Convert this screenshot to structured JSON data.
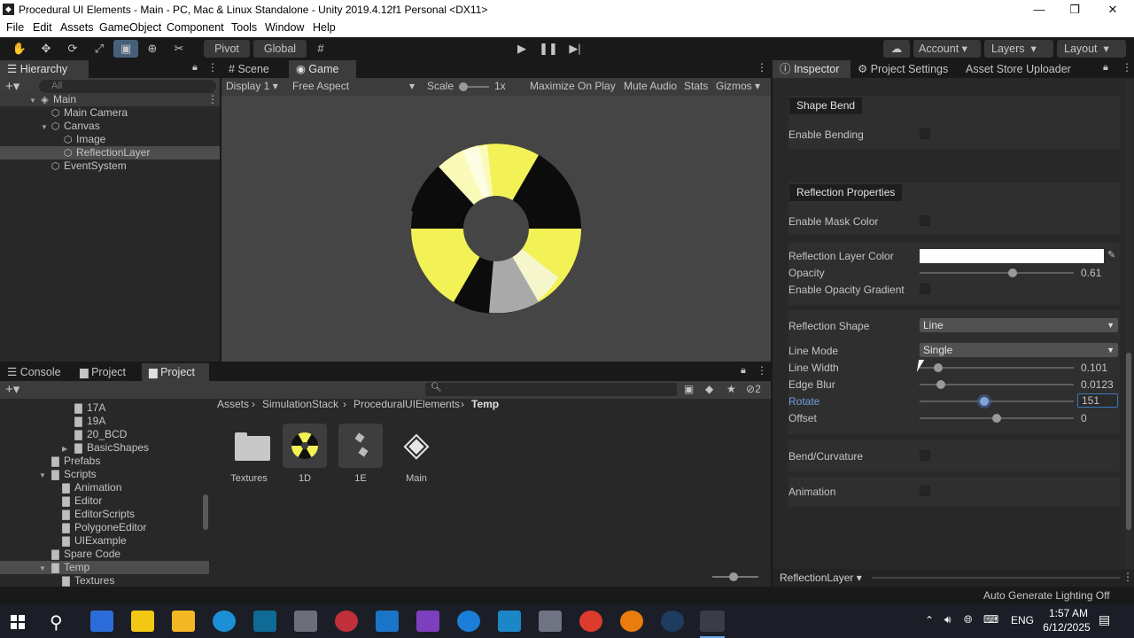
{
  "window": {
    "title": "Procedural UI Elements - Main - PC, Mac & Linux Standalone - Unity 2019.4.12f1 Personal <DX11>"
  },
  "menu": [
    "File",
    "Edit",
    "Assets",
    "GameObject",
    "Component",
    "Tools",
    "Window",
    "Help"
  ],
  "toolbar": {
    "pivot": "Pivot",
    "global": "Global",
    "account": "Account",
    "layers": "Layers",
    "layout": "Layout"
  },
  "hierarchy": {
    "tab": "Hierarchy",
    "search_placeholder": "All",
    "items": [
      "Main",
      "Main Camera",
      "Canvas",
      "Image",
      "ReflectionLayer",
      "EventSystem"
    ]
  },
  "scene_tabs": {
    "scene": "Scene",
    "game": "Game"
  },
  "game_bar": {
    "display": "Display 1",
    "aspect": "Free Aspect",
    "scale_label": "Scale",
    "scale_value": "1x",
    "maximize": "Maximize On Play",
    "mute": "Mute Audio",
    "stats": "Stats",
    "gizmos": "Gizmos"
  },
  "bottom_tabs": {
    "console": "Console",
    "project1": "Project",
    "project2": "Project",
    "hidden_count": "2"
  },
  "project_tree": [
    "17A",
    "19A",
    "20_BCD",
    "BasicShapes",
    "Prefabs",
    "Scripts",
    "Animation",
    "Editor",
    "EditorScripts",
    "PolygoneEditor",
    "UIExample",
    "Spare Code",
    "Temp",
    "Textures"
  ],
  "breadcrumb": [
    "Assets",
    "SimulationStack",
    "ProceduralUIElements",
    "Temp"
  ],
  "assets": [
    "Textures",
    "1D",
    "1E",
    "Main"
  ],
  "inspector": {
    "tabs": [
      "Inspector",
      "Project Settings",
      "Asset Store Uploader"
    ],
    "shape_bend_header": "Shape Bend",
    "enable_bending": "Enable Bending",
    "reflection_header": "Reflection Properties",
    "enable_mask_color": "Enable Mask Color",
    "reflection_layer_color": "Reflection Layer Color",
    "opacity_label": "Opacity",
    "opacity_value": "0.61",
    "enable_opacity_gradient": "Enable Opacity Gradient",
    "reflection_shape_label": "Reflection Shape",
    "reflection_shape_value": "Line",
    "line_mode_label": "Line Mode",
    "line_mode_value": "Single",
    "line_width_label": "Line Width",
    "line_width_value": "0.101",
    "edge_blur_label": "Edge Blur",
    "edge_blur_value": "0.0123",
    "rotate_label": "Rotate",
    "rotate_value": "151",
    "offset_label": "Offset",
    "offset_value": "0",
    "bend_curvature": "Bend/Curvature",
    "animation": "Animation",
    "footer_object": "ReflectionLayer"
  },
  "status": {
    "lighting": "Auto Generate Lighting Off"
  },
  "taskbar": {
    "time": "1:57 AM",
    "date": "6/12/2025",
    "lang": "ENG"
  }
}
